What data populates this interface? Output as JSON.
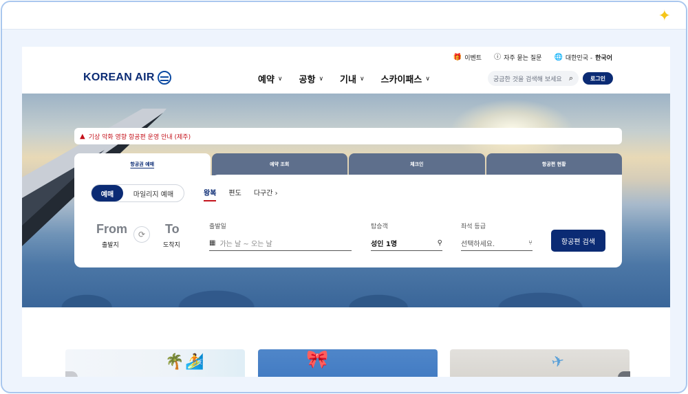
{
  "frame": {
    "sparkle_icon": "sparkle-icon"
  },
  "header": {
    "util": [
      {
        "label": "이벤트",
        "icon": "gift-icon"
      },
      {
        "label": "자주 묻는 질문",
        "icon": "question-icon"
      },
      {
        "label_prefix": "대한민국 - ",
        "label_bold": "한국어",
        "icon": "globe-icon"
      }
    ],
    "logo": "KOREAN AIR",
    "nav": [
      "예약",
      "공항",
      "기내",
      "스카이패스"
    ],
    "search_placeholder": "궁금한 것을 검색해 보세요",
    "login": "로그인"
  },
  "alert": {
    "text": "기상 악화 영향 항공편 운영 안내 (제주)",
    "color": "#c4121b"
  },
  "booking": {
    "tabs": [
      "항공권 예매",
      "예약 조회",
      "체크인",
      "항공편 현황"
    ],
    "mode": {
      "on": "예매",
      "off": "마일리지 예매"
    },
    "trip": {
      "round": "왕복",
      "oneway": "편도",
      "multi": "다구간"
    },
    "origin": {
      "code": "From",
      "label": "출발지"
    },
    "destination": {
      "code": "To",
      "label": "도착지"
    },
    "date": {
      "label": "출발일",
      "placeholder": "가는 날 ~ 오는 날"
    },
    "pax": {
      "label": "탑승객",
      "value": "성인 1명"
    },
    "cabin": {
      "label": "좌석 등급",
      "placeholder": "선택하세요."
    },
    "search_button": "항공편 검색"
  },
  "colors": {
    "brand": "#0b2b74",
    "tab_inactive": "#5e6f8c",
    "alert": "#c4121b"
  }
}
